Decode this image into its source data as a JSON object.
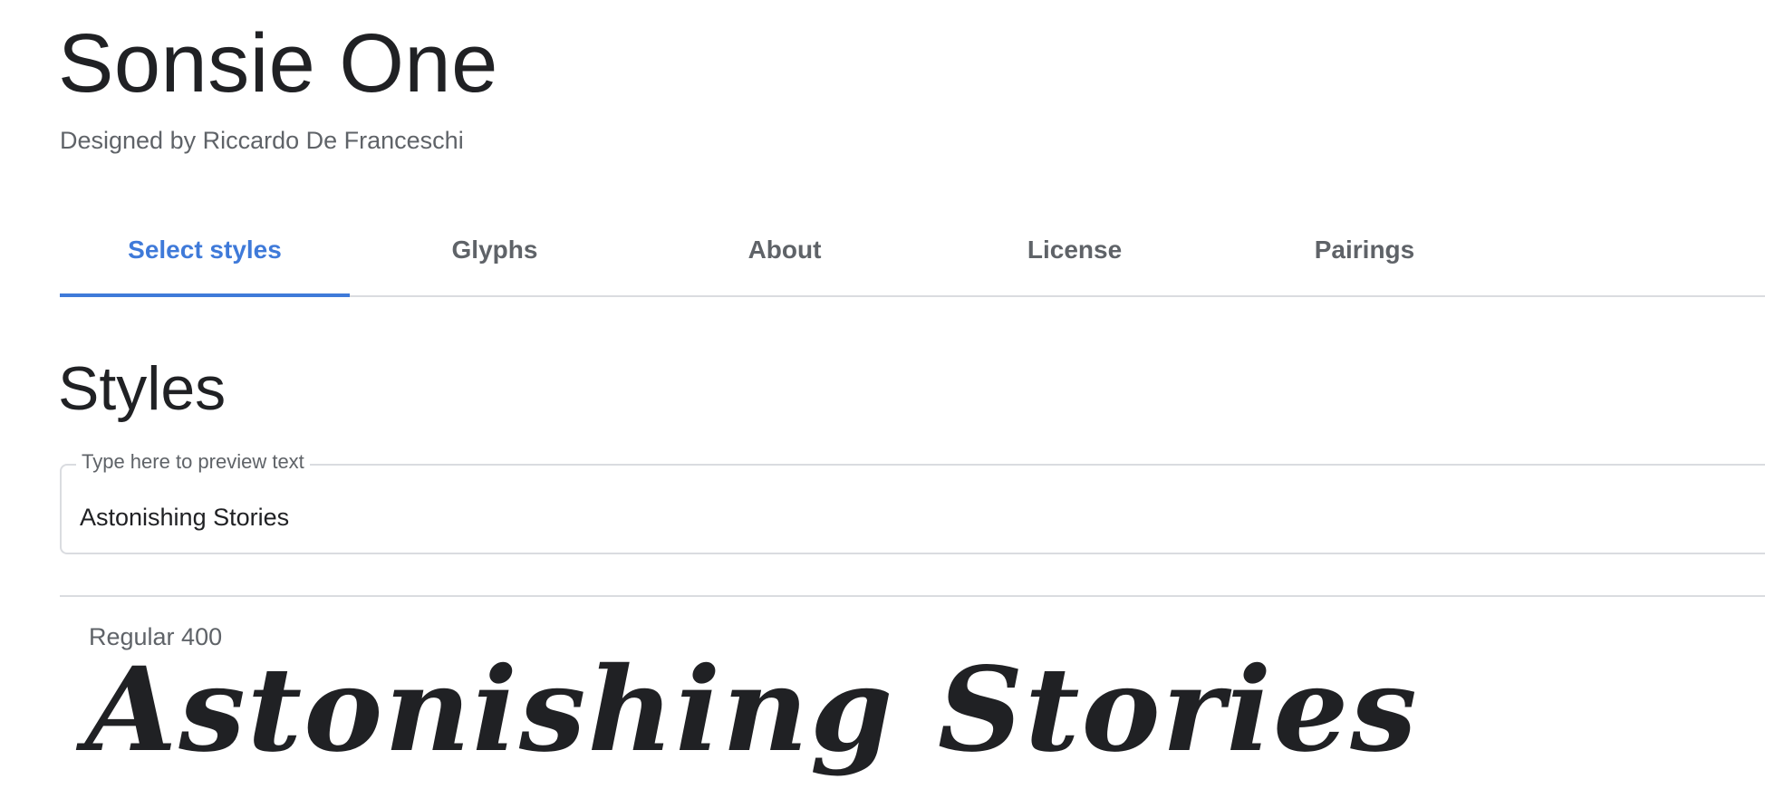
{
  "header": {
    "font_name": "Sonsie One",
    "designer": "Designed by Riccardo De Franceschi"
  },
  "tabs": [
    {
      "label": "Select styles",
      "active": true
    },
    {
      "label": "Glyphs",
      "active": false
    },
    {
      "label": "About",
      "active": false
    },
    {
      "label": "License",
      "active": false
    },
    {
      "label": "Pairings",
      "active": false
    }
  ],
  "styles": {
    "title": "Styles",
    "preview": {
      "label": "Type here to preview text",
      "value": "Astonishing Stories"
    },
    "items": [
      {
        "name": "Regular 400",
        "sample": "Astonishing Stories"
      }
    ]
  },
  "colors": {
    "accent": "#3f7ad9",
    "text_primary": "#202124",
    "text_secondary": "#5f6368",
    "divider": "#dadce0"
  }
}
